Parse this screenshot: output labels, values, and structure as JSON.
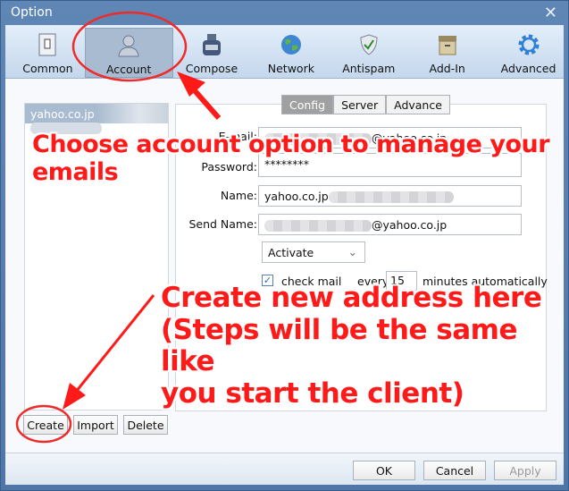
{
  "window": {
    "title": "Option",
    "close_icon": "close-icon"
  },
  "toolbar": {
    "items": [
      {
        "label": "Common",
        "icon": "switch-icon"
      },
      {
        "label": "Account",
        "icon": "user-icon",
        "selected": true
      },
      {
        "label": "Compose",
        "icon": "ink-bottle-icon"
      },
      {
        "label": "Network",
        "icon": "globe-icon"
      },
      {
        "label": "Antispam",
        "icon": "shield-check-icon"
      },
      {
        "label": "Add-In",
        "icon": "box-icon"
      },
      {
        "label": "Advanced",
        "icon": "gear-icon"
      }
    ]
  },
  "accounts": {
    "items": [
      {
        "label": "yahoo.co.jp"
      }
    ],
    "buttons": {
      "create": "Create",
      "import": "Import",
      "delete": "Delete"
    }
  },
  "tabs": [
    {
      "label": "Config",
      "selected": true
    },
    {
      "label": "Server"
    },
    {
      "label": "Advance"
    }
  ],
  "form": {
    "email_label": "E-mail:",
    "email_value": "@yahoo.co.jp",
    "password_label": "Password:",
    "password_value": "********",
    "name_label": "Name:",
    "name_value": "yahoo.co.jp",
    "send_name_label": "Send Name:",
    "send_name_value": "@yahoo.co.jp",
    "status_select": "Activate",
    "check_mail_label": "check mail",
    "check_mail_checked": true,
    "every_label": "every",
    "interval_value": "15",
    "interval_suffix": "minutes automatically"
  },
  "footer": {
    "ok": "OK",
    "cancel": "Cancel",
    "apply": "Apply"
  },
  "annotations": {
    "account_note": "Choose account option to manage your emails",
    "create_note_1": "Create new address here",
    "create_note_2": "(Steps will be the same like",
    "create_note_3": "you start the client)",
    "color": "#ff1a1a"
  }
}
